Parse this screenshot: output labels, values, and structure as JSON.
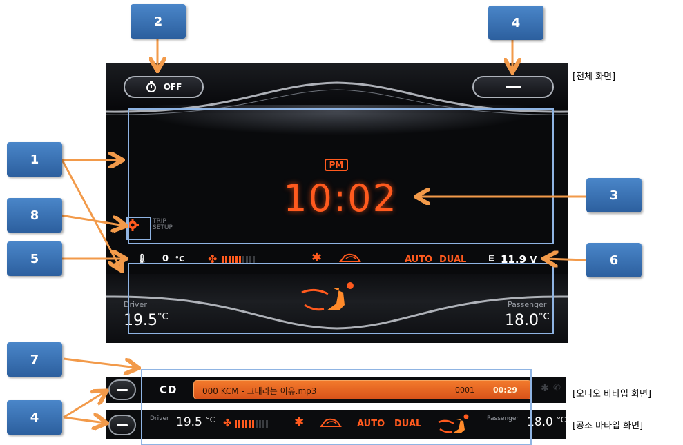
{
  "badges": [
    "1",
    "2",
    "3",
    "4",
    "5",
    "6",
    "7",
    "8",
    "4"
  ],
  "labels": {
    "full_screen": "[전체 화면]",
    "audio_bar": "[오디오 바타입 화면]",
    "climate_bar": "[공조 바타입 화면]"
  },
  "main": {
    "timer_state": "OFF",
    "ampm": "PM",
    "time": "10:02",
    "trip_setup_line1": "TRIP",
    "trip_setup_line2": "SETUP",
    "outside_temp": "0",
    "temp_unit": "°C",
    "auto_label": "AUTO",
    "dual_label": "DUAL",
    "voltage": "11.9",
    "voltage_unit": "V",
    "driver_label": "Driver",
    "driver_temp": "19.5",
    "passenger_label": "Passenger",
    "passenger_temp": "18.0",
    "temp_unit_short": "°C",
    "fan_level": 0.6
  },
  "audio_bar": {
    "source": "CD",
    "track_title": "000 KCM - 그대라는 이유.mp3",
    "track_number": "0001",
    "elapsed": "00:29"
  },
  "climate_bar": {
    "driver_label": "Driver",
    "driver_temp": "19.5",
    "temp_unit": "°C",
    "auto_label": "AUTO",
    "dual_label": "DUAL",
    "passenger_label": "Passenger",
    "passenger_temp": "18.0"
  },
  "colors": {
    "accent": "#ff5a1e",
    "badge": "#3a74b8",
    "highlight": "#8fb4e3",
    "arrow": "#f29a4a"
  }
}
